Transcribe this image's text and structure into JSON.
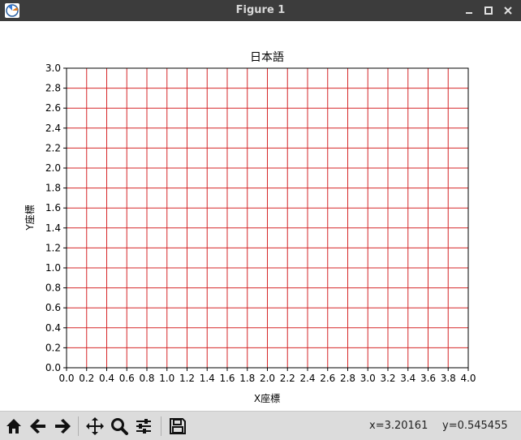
{
  "window": {
    "title": "Figure 1",
    "minimize_icon": "minimize-icon",
    "maximize_icon": "maximize-icon",
    "close_icon": "close-icon"
  },
  "chart_data": {
    "type": "line",
    "title": "日本語",
    "xlabel": "X座標",
    "ylabel": "Y座標",
    "xlim": [
      0.0,
      4.0
    ],
    "ylim": [
      0.0,
      3.0
    ],
    "xticks": [
      "0.0",
      "0.2",
      "0.4",
      "0.6",
      "0.8",
      "1.0",
      "1.2",
      "1.4",
      "1.6",
      "1.8",
      "2.0",
      "2.2",
      "2.4",
      "2.6",
      "2.8",
      "3.0",
      "3.2",
      "3.4",
      "3.6",
      "3.8",
      "4.0"
    ],
    "yticks": [
      "0.0",
      "0.2",
      "0.4",
      "0.6",
      "0.8",
      "1.0",
      "1.2",
      "1.4",
      "1.6",
      "1.8",
      "2.0",
      "2.2",
      "2.4",
      "2.6",
      "2.8",
      "3.0"
    ],
    "grid": true,
    "grid_color": "#d62728",
    "series": []
  },
  "toolbar": {
    "buttons": [
      "home-icon",
      "back-icon",
      "forward-icon",
      "pan-icon",
      "zoom-icon",
      "configure-subplots-icon",
      "save-icon"
    ],
    "x_readout": "x=3.20161",
    "y_readout": "y=0.545455"
  }
}
